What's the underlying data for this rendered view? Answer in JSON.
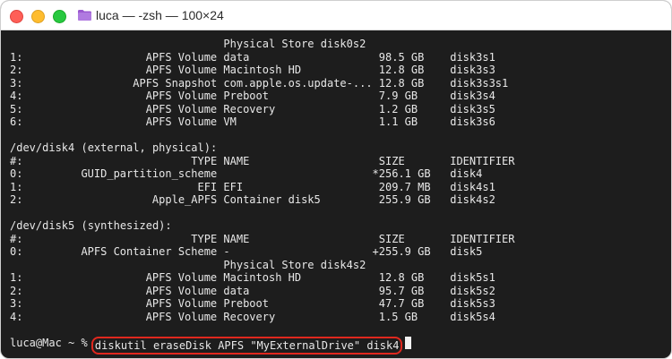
{
  "window": {
    "title": "luca — -zsh — 100×24"
  },
  "columns": {
    "num": "#:",
    "type": "TYPE",
    "name": "NAME",
    "size": "SIZE",
    "id": "IDENTIFIER"
  },
  "sections": [
    {
      "header": null,
      "show_columns": false,
      "rows": [
        {
          "num": "",
          "type": "",
          "name": "Physical Store disk0s2",
          "size": "",
          "id": ""
        },
        {
          "num": "1:",
          "type": "APFS Volume",
          "name": "data",
          "size": "98.5 GB",
          "id": "disk3s1"
        },
        {
          "num": "2:",
          "type": "APFS Volume",
          "name": "Macintosh HD",
          "size": "12.8 GB",
          "id": "disk3s3"
        },
        {
          "num": "3:",
          "type": "APFS Snapshot",
          "name": "com.apple.os.update-...",
          "size": "12.8 GB",
          "id": "disk3s3s1"
        },
        {
          "num": "4:",
          "type": "APFS Volume",
          "name": "Preboot",
          "size": "7.9 GB",
          "id": "disk3s4"
        },
        {
          "num": "5:",
          "type": "APFS Volume",
          "name": "Recovery",
          "size": "1.2 GB",
          "id": "disk3s5"
        },
        {
          "num": "6:",
          "type": "APFS Volume",
          "name": "VM",
          "size": "1.1 GB",
          "id": "disk3s6"
        }
      ]
    },
    {
      "header": "/dev/disk4 (external, physical):",
      "show_columns": true,
      "rows": [
        {
          "num": "0:",
          "type": "GUID_partition_scheme",
          "name": "",
          "size": "*256.1 GB",
          "id": "disk4"
        },
        {
          "num": "1:",
          "type": "EFI",
          "name": "EFI",
          "size": "209.7 MB",
          "id": "disk4s1"
        },
        {
          "num": "2:",
          "type": "Apple_APFS",
          "name": "Container disk5",
          "size": "255.9 GB",
          "id": "disk4s2"
        }
      ]
    },
    {
      "header": "/dev/disk5 (synthesized):",
      "show_columns": true,
      "rows": [
        {
          "num": "0:",
          "type": "APFS Container Scheme",
          "name": "-",
          "size": "+255.9 GB",
          "id": "disk5"
        },
        {
          "num": "",
          "type": "",
          "name": "Physical Store disk4s2",
          "size": "",
          "id": ""
        },
        {
          "num": "1:",
          "type": "APFS Volume",
          "name": "Macintosh HD",
          "size": "12.8 GB",
          "id": "disk5s1"
        },
        {
          "num": "2:",
          "type": "APFS Volume",
          "name": "data",
          "size": "95.7 GB",
          "id": "disk5s2"
        },
        {
          "num": "3:",
          "type": "APFS Volume",
          "name": "Preboot",
          "size": "47.7 GB",
          "id": "disk5s3"
        },
        {
          "num": "4:",
          "type": "APFS Volume",
          "name": "Recovery",
          "size": "1.5 GB",
          "id": "disk5s4"
        }
      ]
    }
  ],
  "prompt": {
    "text": "luca@Mac ~ % ",
    "command": "diskutil eraseDisk APFS \"MyExternalDrive\" disk4"
  },
  "colors": {
    "highlight": "#e0281e",
    "background": "#1d1d1d",
    "folder": "#9b59d0"
  }
}
